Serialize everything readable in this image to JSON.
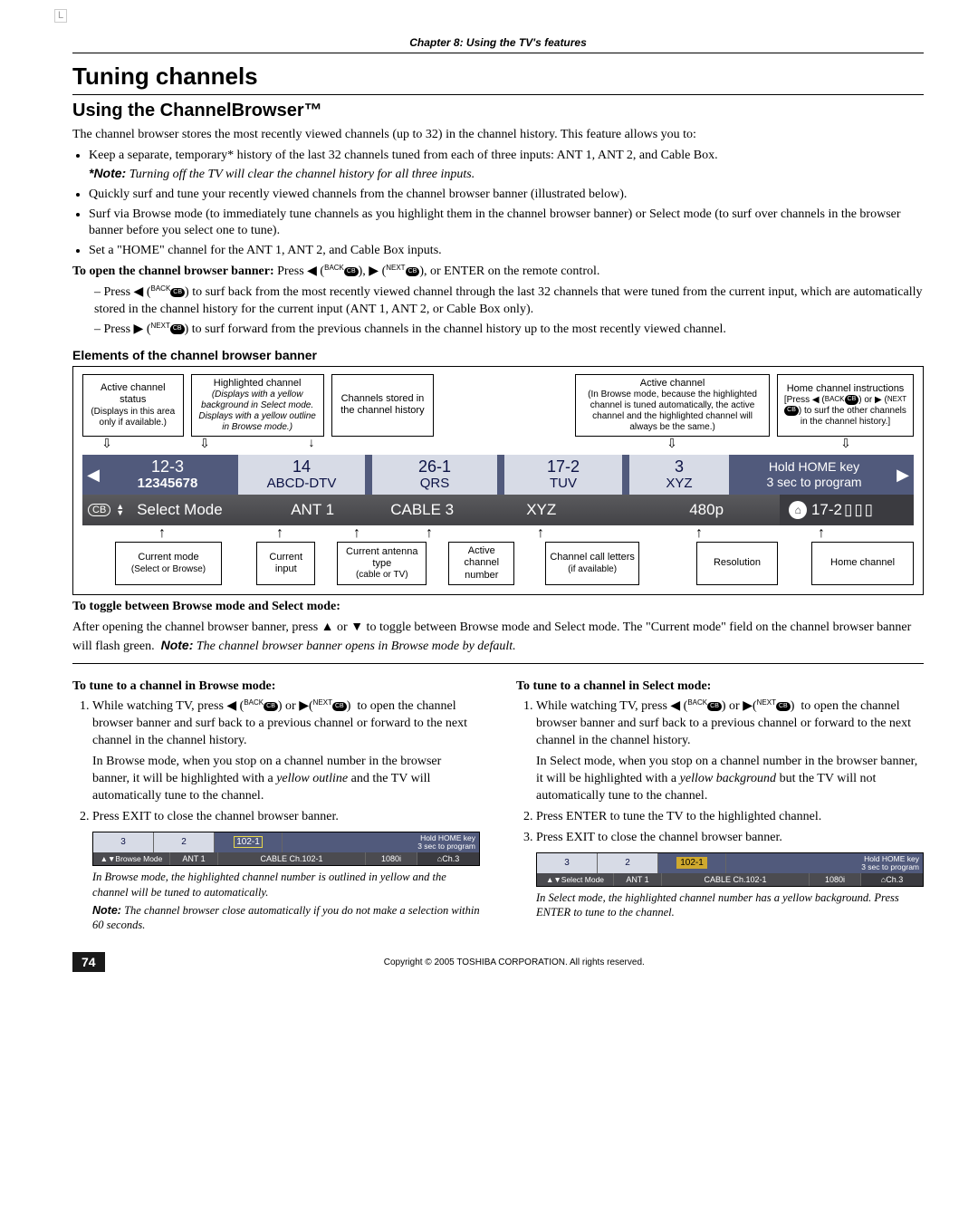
{
  "corner_mark": "L",
  "chapter": "Chapter 8: Using the TV's features",
  "h1": "Tuning channels",
  "h2": "Using the ChannelBrowser™",
  "intro": "The channel browser stores the most recently viewed channels (up to 32) in the channel history. This feature allows you to:",
  "bullets": {
    "b1a": "Keep a separate, temporary* history of the last 32 channels tuned from each of three inputs: ANT 1, ANT 2, and Cable Box.",
    "b1_note_label": "*Note:",
    "b1_note": "Turning off the TV will clear the channel history for all three inputs.",
    "b2": "Quickly surf and tune your recently viewed channels from the channel browser banner (illustrated below).",
    "b3": "Surf via Browse mode (to immediately tune channels as you highlight them in the channel browser banner) or Select mode (to surf over channels in the browser banner before you select one to tune).",
    "b4": "Set a \"HOME\" channel for the ANT 1, ANT 2, and Cable Box inputs."
  },
  "open_banner": {
    "lead": "To open the channel browser banner:",
    "rest": "Press ◀ ( ), ▶ ( ), or ENTER on the remote control.",
    "back_label": "BACK",
    "next_label": "NEXT",
    "cb_glyph": "CB"
  },
  "dash": {
    "d1": "Press ◀ ( ) to surf back from the most recently viewed channel through the last 32 channels that were tuned from the current input, which are automatically stored in the channel history for the current input (ANT 1, ANT 2, or Cable Box only).",
    "d2": "Press ▶ ( ) to surf forward from the previous channels in the channel history up to the most recently viewed channel."
  },
  "elements_title": "Elements of the channel browser banner",
  "labels": {
    "top": {
      "l1_t": "Active channel status",
      "l1_b": "(Displays in this area only if available.)",
      "l2_t": "Highlighted channel",
      "l2_b": "(Displays with a yellow background in Select mode. Displays with a yellow outline in Browse mode.)",
      "l3_t": "Channels stored in the channel history",
      "l4_t": "Active channel",
      "l4_b": "(In Browse mode, because the highlighted channel is tuned automatically, the active channel and the highlighted channel will always be the same.)",
      "l5_t": "Home channel instructions",
      "l5_b": "[Press ◀ ( ) or ▶ ( ) to surf the other channels in the channel history.]"
    },
    "bottom": {
      "b1_t": "Current mode",
      "b1_b": "(Select or Browse)",
      "b2_t": "Current input",
      "b3_t": "Current antenna type",
      "b3_b": "(cable or TV)",
      "b4_t": "Active channel number",
      "b5_t": "Channel call letters",
      "b5_b": "(if available)",
      "b6_t": "Resolution",
      "b7_t": "Home channel"
    }
  },
  "tiles": {
    "t1a": "12-3",
    "t1b": "12345678",
    "t2a": "14",
    "t2b": "ABCD-DTV",
    "t3a": "26-1",
    "t3b": "QRS",
    "t4a": "17-2",
    "t4b": "TUV",
    "t5a": "3",
    "t5b": "XYZ",
    "hold1": "Hold HOME key",
    "hold2": "3 sec to program"
  },
  "status": {
    "cb": "CB",
    "mode": "Select Mode",
    "input": "ANT 1",
    "ant": "CABLE 3",
    "call": "XYZ",
    "res": "480p",
    "home": "17-2"
  },
  "toggle": {
    "head": "To toggle between Browse mode and Select mode:",
    "body": "After opening the channel browser banner, press ▲ or ▼ to toggle between Browse mode and Select mode.  The \"Current mode\" field on the channel browser banner will flash green.",
    "note_label": "Note:",
    "note": "The channel browser banner opens in Browse mode by default."
  },
  "browse": {
    "head": "To tune to a channel in Browse mode:",
    "s1": "While watching TV, press ◀ ( ) or ▶ ( )  to open the channel browser banner and surf back to a previous channel or forward to the next channel in the channel history.",
    "s1_p2": "In Browse mode, when you stop on a channel number in the browser banner, it will be highlighted with a yellow outline and the TV will automatically tune to the channel.",
    "s2": "Press EXIT to close the channel browser banner.",
    "mini": {
      "c1": "3",
      "c2": "2",
      "c3": "102-1",
      "hold1": "Hold HOME key",
      "hold2": "3 sec to program",
      "mode": "Browse Mode",
      "input": "ANT 1",
      "label": "CABLE  Ch.102-1",
      "res": "1080i",
      "home": "Ch.3"
    },
    "caption": "In Browse mode, the highlighted channel number is outlined in yellow and the channel will be tuned to automatically.",
    "note_label": "Note:",
    "note": "The channel browser close automatically if you do not make a selection within 60 seconds."
  },
  "select": {
    "head": "To tune to a channel in Select mode:",
    "s1": "While watching TV, press ◀ ( ) or ▶ ( )  to open the channel browser banner and surf back to a previous channel or forward to the next channel in the channel history.",
    "s1_p2": "In Select mode, when you stop on a channel number in the browser banner, it will be highlighted with a yellow background but the TV will not automatically tune to the channel.",
    "s2": "Press ENTER to tune the TV to the highlighted channel.",
    "s3": "Press EXIT to close the channel browser banner.",
    "mini": {
      "c1": "3",
      "c2": "2",
      "c3": "102-1",
      "hold1": "Hold HOME key",
      "hold2": "3 sec to program",
      "mode": "Select Mode",
      "input": "ANT 1",
      "label": "CABLE  Ch.102-1",
      "res": "1080i",
      "home": "Ch.3"
    },
    "caption": "In Select mode, the highlighted channel number has a yellow background. Press ENTER to tune to the channel."
  },
  "footer": {
    "page": "74",
    "copyright": "Copyright © 2005 TOSHIBA CORPORATION. All rights reserved."
  }
}
